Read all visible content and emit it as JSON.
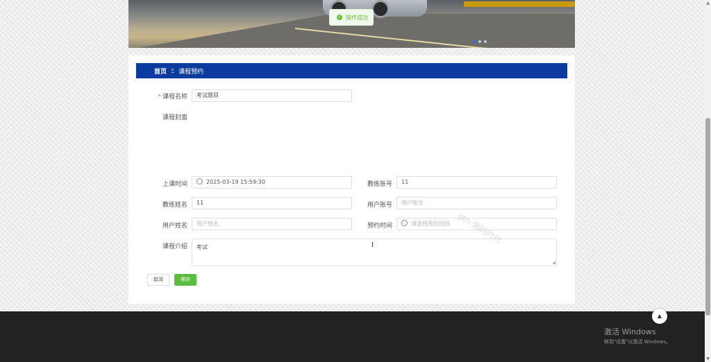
{
  "toast": {
    "message": "操作成功"
  },
  "breadcrumb": {
    "home": "首页",
    "separator": "Ξ",
    "current": "课程预约"
  },
  "form": {
    "course_name": {
      "label": "课程名称",
      "required_mark": "*",
      "value": "考试题目"
    },
    "course_cover": {
      "label": "课程封面"
    },
    "class_time": {
      "label": "上课时间",
      "value": "2025-03-19 15:59:30"
    },
    "coach_account": {
      "label": "教练账号",
      "value": "11"
    },
    "coach_name": {
      "label": "教练姓名",
      "value": "11"
    },
    "user_account": {
      "label": "用户账号",
      "placeholder": "用户账号"
    },
    "user_name": {
      "label": "用户姓名",
      "placeholder": "用户姓名"
    },
    "booking_time": {
      "label": "预约时间",
      "placeholder": "请选择预约时间"
    },
    "course_intro": {
      "label": "课程介绍",
      "value": "考试"
    }
  },
  "buttons": {
    "cancel": "取消",
    "save": "保存"
  },
  "watermark": "gtn 源码时代",
  "windows": {
    "line1": "激活 Windows",
    "line2": "转到\"设置\"以激活 Windows。"
  },
  "colors": {
    "header_bar": "#0b3b9e",
    "save_button": "#5cbd3a",
    "success": "#67c23a"
  },
  "icons": [
    "check-circle-icon",
    "clock-icon",
    "arrow-up-icon"
  ],
  "carousel": {
    "slides": 3,
    "active": 1
  }
}
